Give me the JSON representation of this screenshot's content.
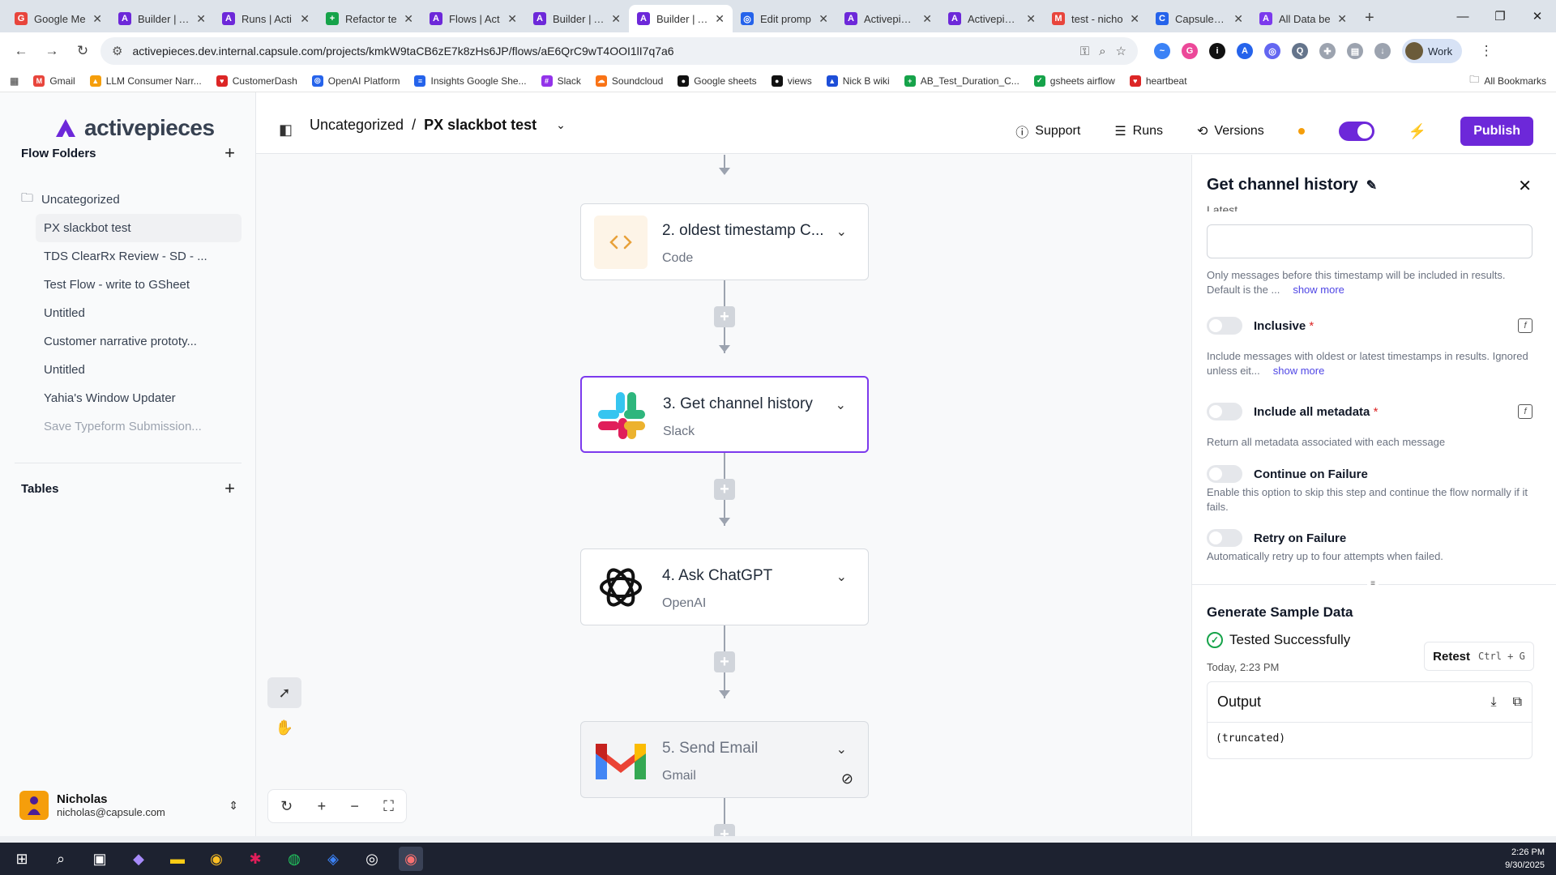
{
  "browser": {
    "tabs": [
      {
        "label": "Google Me",
        "color": "#e8453c",
        "glyph": "G"
      },
      {
        "label": "Builder | Ac",
        "color": "#6d28d9",
        "glyph": "A"
      },
      {
        "label": "Runs | Acti",
        "color": "#6d28d9",
        "glyph": "A"
      },
      {
        "label": "Refactor te",
        "color": "#16a34a",
        "glyph": "+"
      },
      {
        "label": "Flows | Act",
        "color": "#6d28d9",
        "glyph": "A"
      },
      {
        "label": "Builder | Ac",
        "color": "#6d28d9",
        "glyph": "A"
      },
      {
        "label": "Builder | Ac",
        "color": "#6d28d9",
        "glyph": "A",
        "active": true
      },
      {
        "label": "Edit promp",
        "color": "#2563eb",
        "glyph": "◎"
      },
      {
        "label": "Activepiece",
        "color": "#6d28d9",
        "glyph": "A"
      },
      {
        "label": "Activepiece",
        "color": "#6d28d9",
        "glyph": "A"
      },
      {
        "label": "test - nicho",
        "color": "#e8453c",
        "glyph": "M"
      },
      {
        "label": "Capsule - C",
        "color": "#2563eb",
        "glyph": "C"
      },
      {
        "label": "All Data be",
        "color": "#7c3aed",
        "glyph": "A"
      }
    ],
    "url": "activepieces.dev.internal.capsule.com/projects/kmkW9taCB6zE7k8zHs6JP/flows/aE6QrC9wT4OOI1lI7q7a6",
    "profile_label": "Work",
    "bookmarks": [
      {
        "label": "Gmail",
        "color": "#e8453c",
        "glyph": "M"
      },
      {
        "label": "LLM Consumer Narr...",
        "color": "#f59e0b",
        "glyph": "▲"
      },
      {
        "label": "CustomerDash",
        "color": "#dc2626",
        "glyph": "♥"
      },
      {
        "label": "OpenAI Platform",
        "color": "#2563eb",
        "glyph": "◎"
      },
      {
        "label": "Insights Google She...",
        "color": "#2563eb",
        "glyph": "≡"
      },
      {
        "label": "Slack",
        "color": "#9333ea",
        "glyph": "#"
      },
      {
        "label": "Soundcloud",
        "color": "#f97316",
        "glyph": "☁"
      },
      {
        "label": "Google sheets",
        "color": "#111",
        "glyph": "●"
      },
      {
        "label": "views",
        "color": "#111",
        "glyph": "●"
      },
      {
        "label": "Nick B wiki",
        "color": "#1d4ed8",
        "glyph": "▲"
      },
      {
        "label": "AB_Test_Duration_C...",
        "color": "#16a34a",
        "glyph": "+"
      },
      {
        "label": "gsheets airflow",
        "color": "#16a34a",
        "glyph": "✓"
      },
      {
        "label": "heartbeat",
        "color": "#dc2626",
        "glyph": "♥"
      }
    ],
    "all_bookmarks": "All Bookmarks"
  },
  "sidebar": {
    "logo_text": "activepieces",
    "flow_folders_title": "Flow Folders",
    "folder_name": "Uncategorized",
    "flows": [
      {
        "label": "PX slackbot test",
        "active": true
      },
      {
        "label": "TDS ClearRx Review - SD - ..."
      },
      {
        "label": "Test Flow - write to GSheet"
      },
      {
        "label": "Untitled"
      },
      {
        "label": "Customer narrative prototy..."
      },
      {
        "label": "Untitled"
      },
      {
        "label": "Yahia's Window Updater"
      },
      {
        "label": "Save Typeform Submission...",
        "faded": true
      }
    ],
    "tables_title": "Tables",
    "user": {
      "name": "Nicholas",
      "email": "nicholas@capsule.com"
    }
  },
  "topbar": {
    "folder": "Uncategorized",
    "separator": "/",
    "flow_name": "PX slackbot test",
    "support": "Support",
    "runs": "Runs",
    "versions": "Versions",
    "publish": "Publish"
  },
  "steps": [
    {
      "title": "2. oldest timestamp C...",
      "subtitle": "Code",
      "icon": "code-icon"
    },
    {
      "title": "3. Get channel history",
      "subtitle": "Slack",
      "icon": "slack-icon",
      "selected": true
    },
    {
      "title": "4. Ask ChatGPT",
      "subtitle": "OpenAI",
      "icon": "openai-icon"
    },
    {
      "title": "5. Send Email",
      "subtitle": "Gmail",
      "icon": "gmail-icon",
      "disabled": true
    }
  ],
  "panel": {
    "title": "Get channel history",
    "latest_label": "Latest",
    "latest_help": "Only messages before this timestamp will be included in results. Default is the ...",
    "show_more": "show more",
    "inclusive_label": "Inclusive",
    "inclusive_help": "Include messages with oldest or latest timestamps in results. Ignored unless eit...",
    "metadata_label": "Include all metadata",
    "metadata_help": "Return all metadata associated with each message",
    "continue_label": "Continue on Failure",
    "continue_help": "Enable this option to skip this step and continue the flow normally if it fails.",
    "retry_label": "Retry on Failure",
    "retry_help": "Automatically retry up to four attempts when failed.",
    "required_mark": "*",
    "generate_title": "Generate Sample Data",
    "tested_status": "Tested Successfully",
    "tested_time": "Today, 2:23 PM",
    "retest": "Retest",
    "retest_shortcut": "Ctrl + G",
    "output_title": "Output",
    "output_body": "(truncated)"
  },
  "taskbar": {
    "time": "2:26 PM",
    "date": "9/30/2025"
  },
  "colors": {
    "accent": "#6d28d9",
    "success": "#16a34a",
    "required": "#dc2626"
  }
}
